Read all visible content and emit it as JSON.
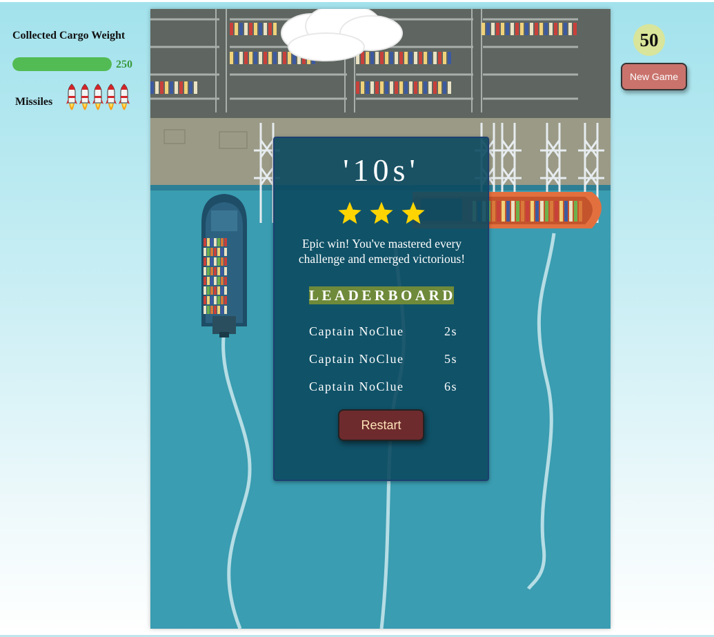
{
  "hud": {
    "cargo_title": "Collected Cargo Weight",
    "cargo_value": "250",
    "cargo_progress": 1.0,
    "missiles_label": "Missiles",
    "missile_count": 5,
    "score": "50",
    "new_game_label": "New Game"
  },
  "result": {
    "time": "'10s'",
    "stars": 3,
    "message": "Epic win! You've mastered every challenge and emerged victorious!",
    "leaderboard_title": "LEADERBOARD",
    "leaderboard": [
      {
        "name": "Captain NoClue",
        "time": "2s"
      },
      {
        "name": "Captain NoClue",
        "time": "5s"
      },
      {
        "name": "Captain NoClue",
        "time": "6s"
      }
    ],
    "restart_label": "Restart"
  },
  "colors": {
    "water": "#3a9db1",
    "dock": "#5f6661",
    "panel": "#0c4a60",
    "star": "#ffd400",
    "cargo_bar": "#52bb54",
    "new_game": "#c9736c",
    "restart": "#6e2b2d",
    "leaderboard_bg": "#6e8a3a"
  }
}
